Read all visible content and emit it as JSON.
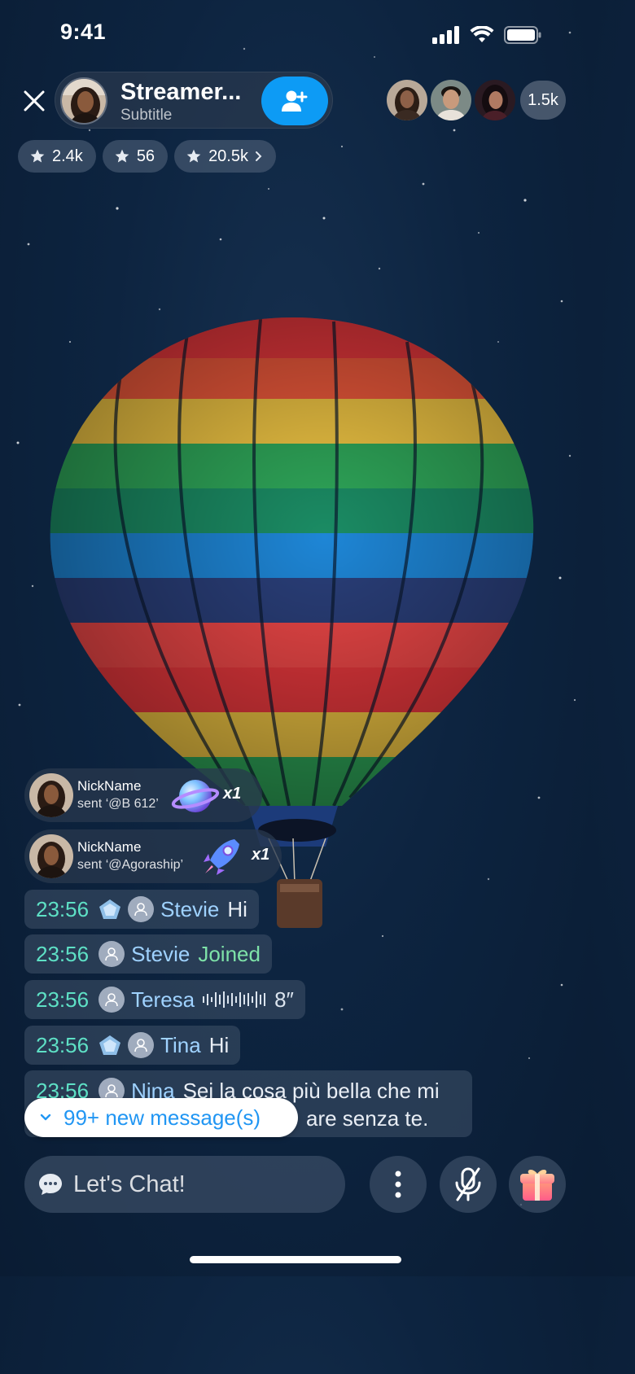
{
  "status_bar": {
    "time": "9:41"
  },
  "header": {
    "streamer_name": "Streamer...",
    "subtitle": "Subtitle",
    "viewer_count": "1.5k"
  },
  "stats": [
    {
      "icon": "star-icon",
      "value": "2.4k"
    },
    {
      "icon": "star-icon",
      "value": "56"
    },
    {
      "icon": "star-icon",
      "value": "20.5k"
    }
  ],
  "gifts": [
    {
      "name": "NickName",
      "sent": "sent ‘@B 612’",
      "gift_icon": "planet-icon",
      "count": "x1"
    },
    {
      "name": "NickName",
      "sent": "sent ‘@Agoraship’",
      "gift_icon": "rocket-icon",
      "count": "x1"
    }
  ],
  "messages": [
    {
      "time": "23:56",
      "user": "Stevie",
      "text": "Hi"
    },
    {
      "time": "23:56",
      "user": "Stevie",
      "text": "Joined"
    },
    {
      "time": "23:56",
      "user": "Teresa",
      "text": "8″"
    },
    {
      "time": "23:56",
      "user": "Tina",
      "text": "Hi"
    },
    {
      "time": "23:56",
      "user": "Nina",
      "text_line1": "Sei la cosa più bella che mi",
      "text_line2": "are senza te."
    }
  ],
  "new_messages": "99+ new message(s)",
  "chat_input": {
    "placeholder": "Let's Chat!"
  },
  "colors": {
    "accent": "#0d9bf5",
    "time": "#5ee0c5",
    "username": "#9fd2ff",
    "joined": "#7ee2a8"
  }
}
